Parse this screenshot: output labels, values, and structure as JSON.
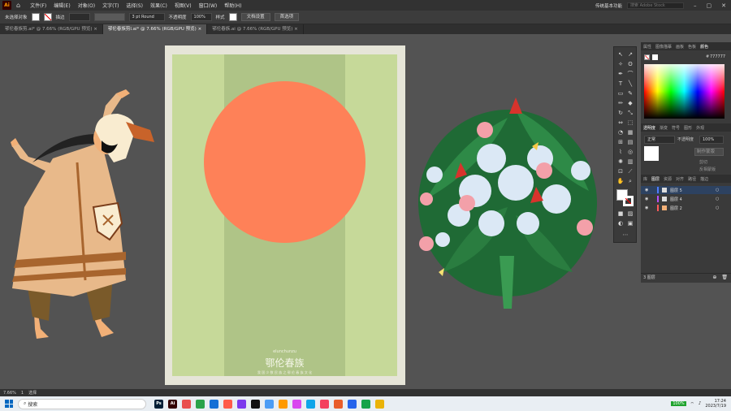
{
  "app": {
    "logo": "Ai",
    "home_icon": "home-icon"
  },
  "menu": [
    "文件(F)",
    "编辑(E)",
    "对象(O)",
    "文字(T)",
    "选择(S)",
    "效果(C)",
    "视图(V)",
    "窗口(W)",
    "帮助(H)"
  ],
  "workspace": {
    "label": "传统基本功能",
    "search_placeholder": "搜索 Adobe Stock"
  },
  "control": {
    "selection_label": "未选择对象",
    "stroke_label": "描边",
    "brush": "3 pt Round",
    "opacity_label": "不透明度",
    "opacity_value": "100%",
    "style_label": "样式",
    "doc_setup": "文档设置",
    "preferences": "首选项"
  },
  "tabs": [
    {
      "label": "鄂伦春族剪.ai* @ 7.66% (RGB/GPU 预览)",
      "close": "×"
    },
    {
      "label": "鄂伦春族剪l.ai* @ 7.66% (RGB/GPU 预览)",
      "close": "×"
    },
    {
      "label": "鄂伦春族.ai @ 7.66% (RGB/GPU 预览)",
      "close": "×"
    }
  ],
  "poster": {
    "subtitle": "elunchunzu",
    "title": "鄂伦春族",
    "caption": "我 国 少 数 民 族 之 鄂 伦 春 族 文 化",
    "colors": {
      "bg": "#c6d999",
      "stripe": "#afc487",
      "sun": "#fe8158",
      "frame": "#e6e5d8"
    }
  },
  "color_panel": {
    "tabs": [
      "属性",
      "图像描摹",
      "画板",
      "色板",
      "颜色"
    ],
    "hex": "777777"
  },
  "transparency_panel": {
    "tabs": [
      "透明度",
      "渐变",
      "符号",
      "图形",
      "外观"
    ],
    "blend_mode": "正常",
    "opacity_label": "不透明度",
    "opacity_value": "100%",
    "make_mask": "制作蒙版",
    "clip": "剪切",
    "invert": "反相蒙版"
  },
  "layers_panel": {
    "tabs": [
      "库",
      "图层",
      "资源",
      "对齐",
      "路径",
      "描边"
    ],
    "layers": [
      {
        "name": "图层 5",
        "color": "#4f7dff",
        "selected": true
      },
      {
        "name": "图层 4",
        "color": "#b54fff",
        "selected": false
      },
      {
        "name": "图层 2",
        "color": "#ff5a5a",
        "selected": false
      }
    ],
    "count": "3 图层"
  },
  "status": {
    "zoom": "7.66%",
    "page": "1",
    "tool": "选择"
  },
  "taskbar": {
    "search": "搜索",
    "apps": [
      {
        "label": "Ps",
        "color": "#001e36"
      },
      {
        "label": "Ai",
        "color": "#330000"
      },
      {
        "label": "",
        "color": "#e94e4e"
      },
      {
        "label": "",
        "color": "#2aa34a"
      },
      {
        "label": "",
        "color": "#1570d6"
      },
      {
        "label": "",
        "color": "#ff5b4a"
      },
      {
        "label": "",
        "color": "#7c3aed"
      },
      {
        "label": "",
        "color": "#111111"
      },
      {
        "label": "",
        "color": "#4b9cf5"
      },
      {
        "label": "",
        "color": "#ff9a00"
      },
      {
        "label": "",
        "color": "#d946ef"
      },
      {
        "label": "",
        "color": "#0ea5e9"
      },
      {
        "label": "",
        "color": "#f43f5e"
      },
      {
        "label": "",
        "color": "#e85d2a"
      },
      {
        "label": "",
        "color": "#2563eb"
      },
      {
        "label": "",
        "color": "#16a34a"
      },
      {
        "label": "",
        "color": "#eab308"
      }
    ],
    "battery": "100%",
    "time": "17:24",
    "date": "2023/7/19"
  }
}
